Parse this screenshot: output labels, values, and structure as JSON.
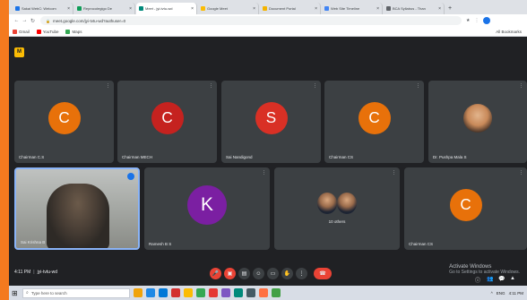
{
  "browser": {
    "tabs": [
      {
        "label": "Sakai WebC: Welcom",
        "color": "#1a73e8",
        "active": false
      },
      {
        "label": "Reprocolegigo De",
        "color": "#0f9d58",
        "active": false
      },
      {
        "label": "Meet - jyi-tvtu-wd",
        "color": "#00897b",
        "active": true
      },
      {
        "label": "Google Meet",
        "color": "#fbbc04",
        "active": false
      },
      {
        "label": "Document Portal",
        "color": "#f4b400",
        "active": false
      },
      {
        "label": "Web Site Timeline",
        "color": "#4285f4",
        "active": false
      },
      {
        "label": "BCA Syllabus - Than",
        "color": "#5f6368",
        "active": false
      }
    ],
    "newtab": "+",
    "back": "←",
    "forward": "→",
    "reload": "↻",
    "url": "meet.google.com/jyi-tvtu-wd?authuser=0",
    "toolbar_icons": [
      "★",
      "⋮"
    ],
    "bookmarks": [
      {
        "label": "Gmail",
        "color": "#ea4335"
      },
      {
        "label": "YouTube",
        "color": "#ff0000"
      },
      {
        "label": "Maps",
        "color": "#34a853"
      }
    ],
    "all_bookmarks": "All Bookmarks"
  },
  "meet": {
    "logo_char": "M",
    "tiles": [
      {
        "name": "Chairman C.S",
        "initial": "C",
        "color": "#e8710a"
      },
      {
        "name": "Chairman MECH",
        "initial": "C",
        "color": "#c5221f"
      },
      {
        "name": "Sai Nandigond",
        "initial": "S",
        "color": "#d93025"
      },
      {
        "name": "Chairman CS",
        "initial": "C",
        "color": "#e8710a"
      },
      {
        "name": "Dr. Pushpa Mala S",
        "initial": "",
        "color": "#c98a5a"
      },
      {
        "name": "Sai Krishna B",
        "initial": "",
        "color": "#6b6b6b"
      },
      {
        "name": "Ramesh B S",
        "initial": "K",
        "color": "#7b1fa2"
      },
      {
        "name": "10 others",
        "initial": "",
        "color": "#3c4043"
      },
      {
        "name": "Chairman CS",
        "initial": "C",
        "color": "#e8710a"
      }
    ],
    "pin_icon": "⋮",
    "time": "4:11 PM",
    "separator": "|",
    "meeting_code": "jyi-tvtu-wd",
    "activate_title": "Activate Windows",
    "activate_sub": "Go to Settings to activate Windows."
  },
  "controls": [
    {
      "name": "mic-off",
      "glyph": "🎤",
      "warn": true
    },
    {
      "name": "camera-off",
      "glyph": "▣",
      "warn": true
    },
    {
      "name": "captions",
      "glyph": "▤",
      "warn": false
    },
    {
      "name": "emoji",
      "glyph": "☺",
      "warn": false
    },
    {
      "name": "present",
      "glyph": "▭",
      "warn": false
    },
    {
      "name": "raise-hand",
      "glyph": "✋",
      "warn": false
    },
    {
      "name": "more-options",
      "glyph": "⋮",
      "warn": false
    }
  ],
  "end_call_glyph": "☎",
  "side_icons": [
    "ⓘ",
    "👥",
    "💬",
    "▲"
  ],
  "taskbar": {
    "start_glyph": "⊞",
    "search_placeholder": "Type here to search",
    "apps": [
      "#f0a30a",
      "#1e88e5",
      "#0078d7",
      "#d32f2f",
      "#fbbc04",
      "#34a853",
      "#e53935",
      "#7e57c2",
      "#00897b",
      "#455a64",
      "#ff7043",
      "#43a047"
    ],
    "tray_items": [
      "^",
      "ENG",
      "4:11 PM"
    ]
  }
}
